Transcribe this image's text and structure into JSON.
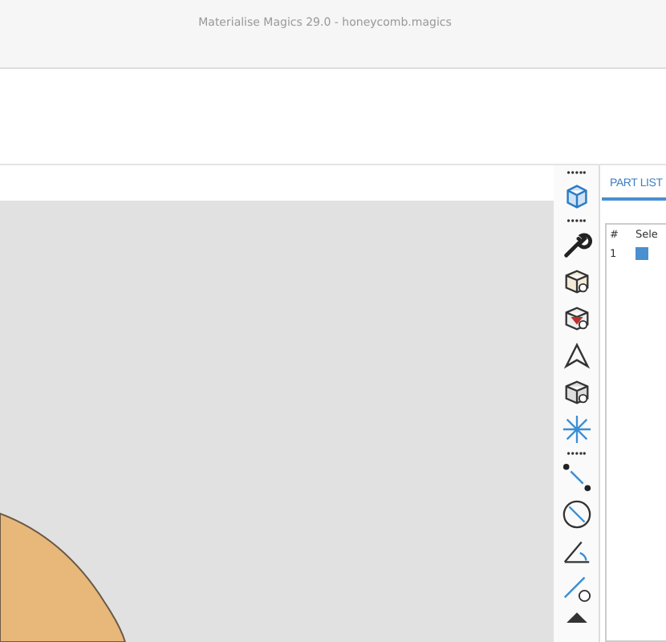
{
  "window": {
    "title": "Materialise Magics 29.0 - honeycomb.magics"
  },
  "tabs": [
    {
      "label": "PART LIST",
      "selected": true
    }
  ],
  "part_table": {
    "columns": [
      "#",
      "Sele"
    ],
    "rows": [
      {
        "index": "1",
        "checked": true
      }
    ]
  }
}
